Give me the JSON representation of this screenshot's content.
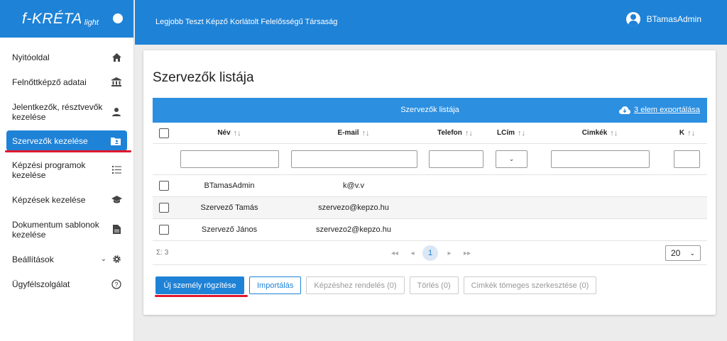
{
  "brand": {
    "name": "f-KRÉTA",
    "sub": "light"
  },
  "header": {
    "organization": "Legjobb Teszt Képző Korlátolt Felelősségű Társaság",
    "user": "BTamasAdmin"
  },
  "sidebar": {
    "items": [
      {
        "label": "Nyitóoldal",
        "icon": "home-icon"
      },
      {
        "label": "Felnőttképző adatai",
        "icon": "bank-icon"
      },
      {
        "label": "Jelentkezők, résztvevők kezelése",
        "icon": "person-icon"
      },
      {
        "label": "Szervezők kezelése",
        "icon": "folder-person-icon",
        "active": true
      },
      {
        "label": "Képzési programok kezelése",
        "icon": "list-icon"
      },
      {
        "label": "Képzések kezelése",
        "icon": "graduation-cap-icon"
      },
      {
        "label": "Dokumentum sablonok kezelése",
        "icon": "document-icon"
      },
      {
        "label": "Beállítások",
        "icon": "gear-icon"
      },
      {
        "label": "Ügyfélszolgálat",
        "icon": "help-icon"
      }
    ]
  },
  "main": {
    "title": "Szervezők listája",
    "table": {
      "title": "Szervezők listája",
      "export_label": "3 elem exportálása",
      "columns": [
        "Név",
        "E-mail",
        "Telefon",
        "LCím",
        "Cimkék",
        "K"
      ],
      "rows": [
        {
          "name": "BTamasAdmin",
          "email": "k@v.v"
        },
        {
          "name": "Szervező Tamás",
          "email": "szervezo@kepzo.hu"
        },
        {
          "name": "Szervező János",
          "email": "szervezo2@kepzo.hu"
        }
      ],
      "sum_label": "Σ: 3",
      "current_page": "1",
      "page_size": "20"
    },
    "buttons": {
      "new_person": "Új személy rögzítése",
      "import": "Importálás",
      "assign": "Képzéshez rendelés (0)",
      "delete": "Törlés (0)",
      "tags_bulk": "Cimkék tömeges szerkesztése (0)"
    }
  },
  "colors": {
    "primary": "#1e82d7",
    "highlight": "#e0182d"
  }
}
